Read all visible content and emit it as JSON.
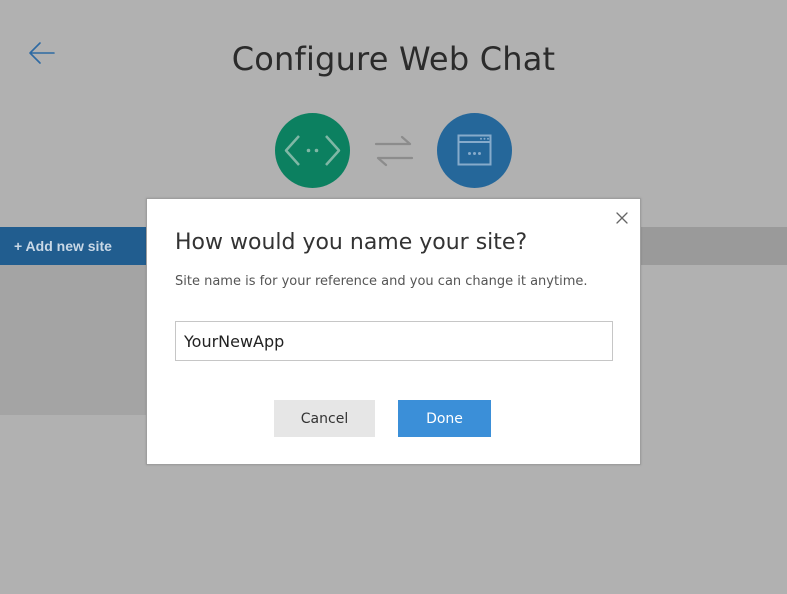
{
  "header": {
    "title": "Configure Web Chat",
    "back_icon": "arrow-left-icon"
  },
  "flow_icons": {
    "code_icon": "code-brackets-icon",
    "swap_icon": "swap-arrows-icon",
    "window_icon": "browser-window-icon",
    "code_color": "#0c8060",
    "window_color": "#25679a"
  },
  "sidebar": {
    "add_site_label": "+ Add new site"
  },
  "dialog": {
    "title": "How would you name your site?",
    "description": "Site name is for your reference and you can change it anytime.",
    "input_value": "YourNewApp",
    "cancel_label": "Cancel",
    "done_label": "Done",
    "close_icon": "close-icon"
  },
  "colors": {
    "overlay": "#b1b1b1",
    "primary_button": "#3b8fd8",
    "secondary_button": "#e6e6e6"
  }
}
